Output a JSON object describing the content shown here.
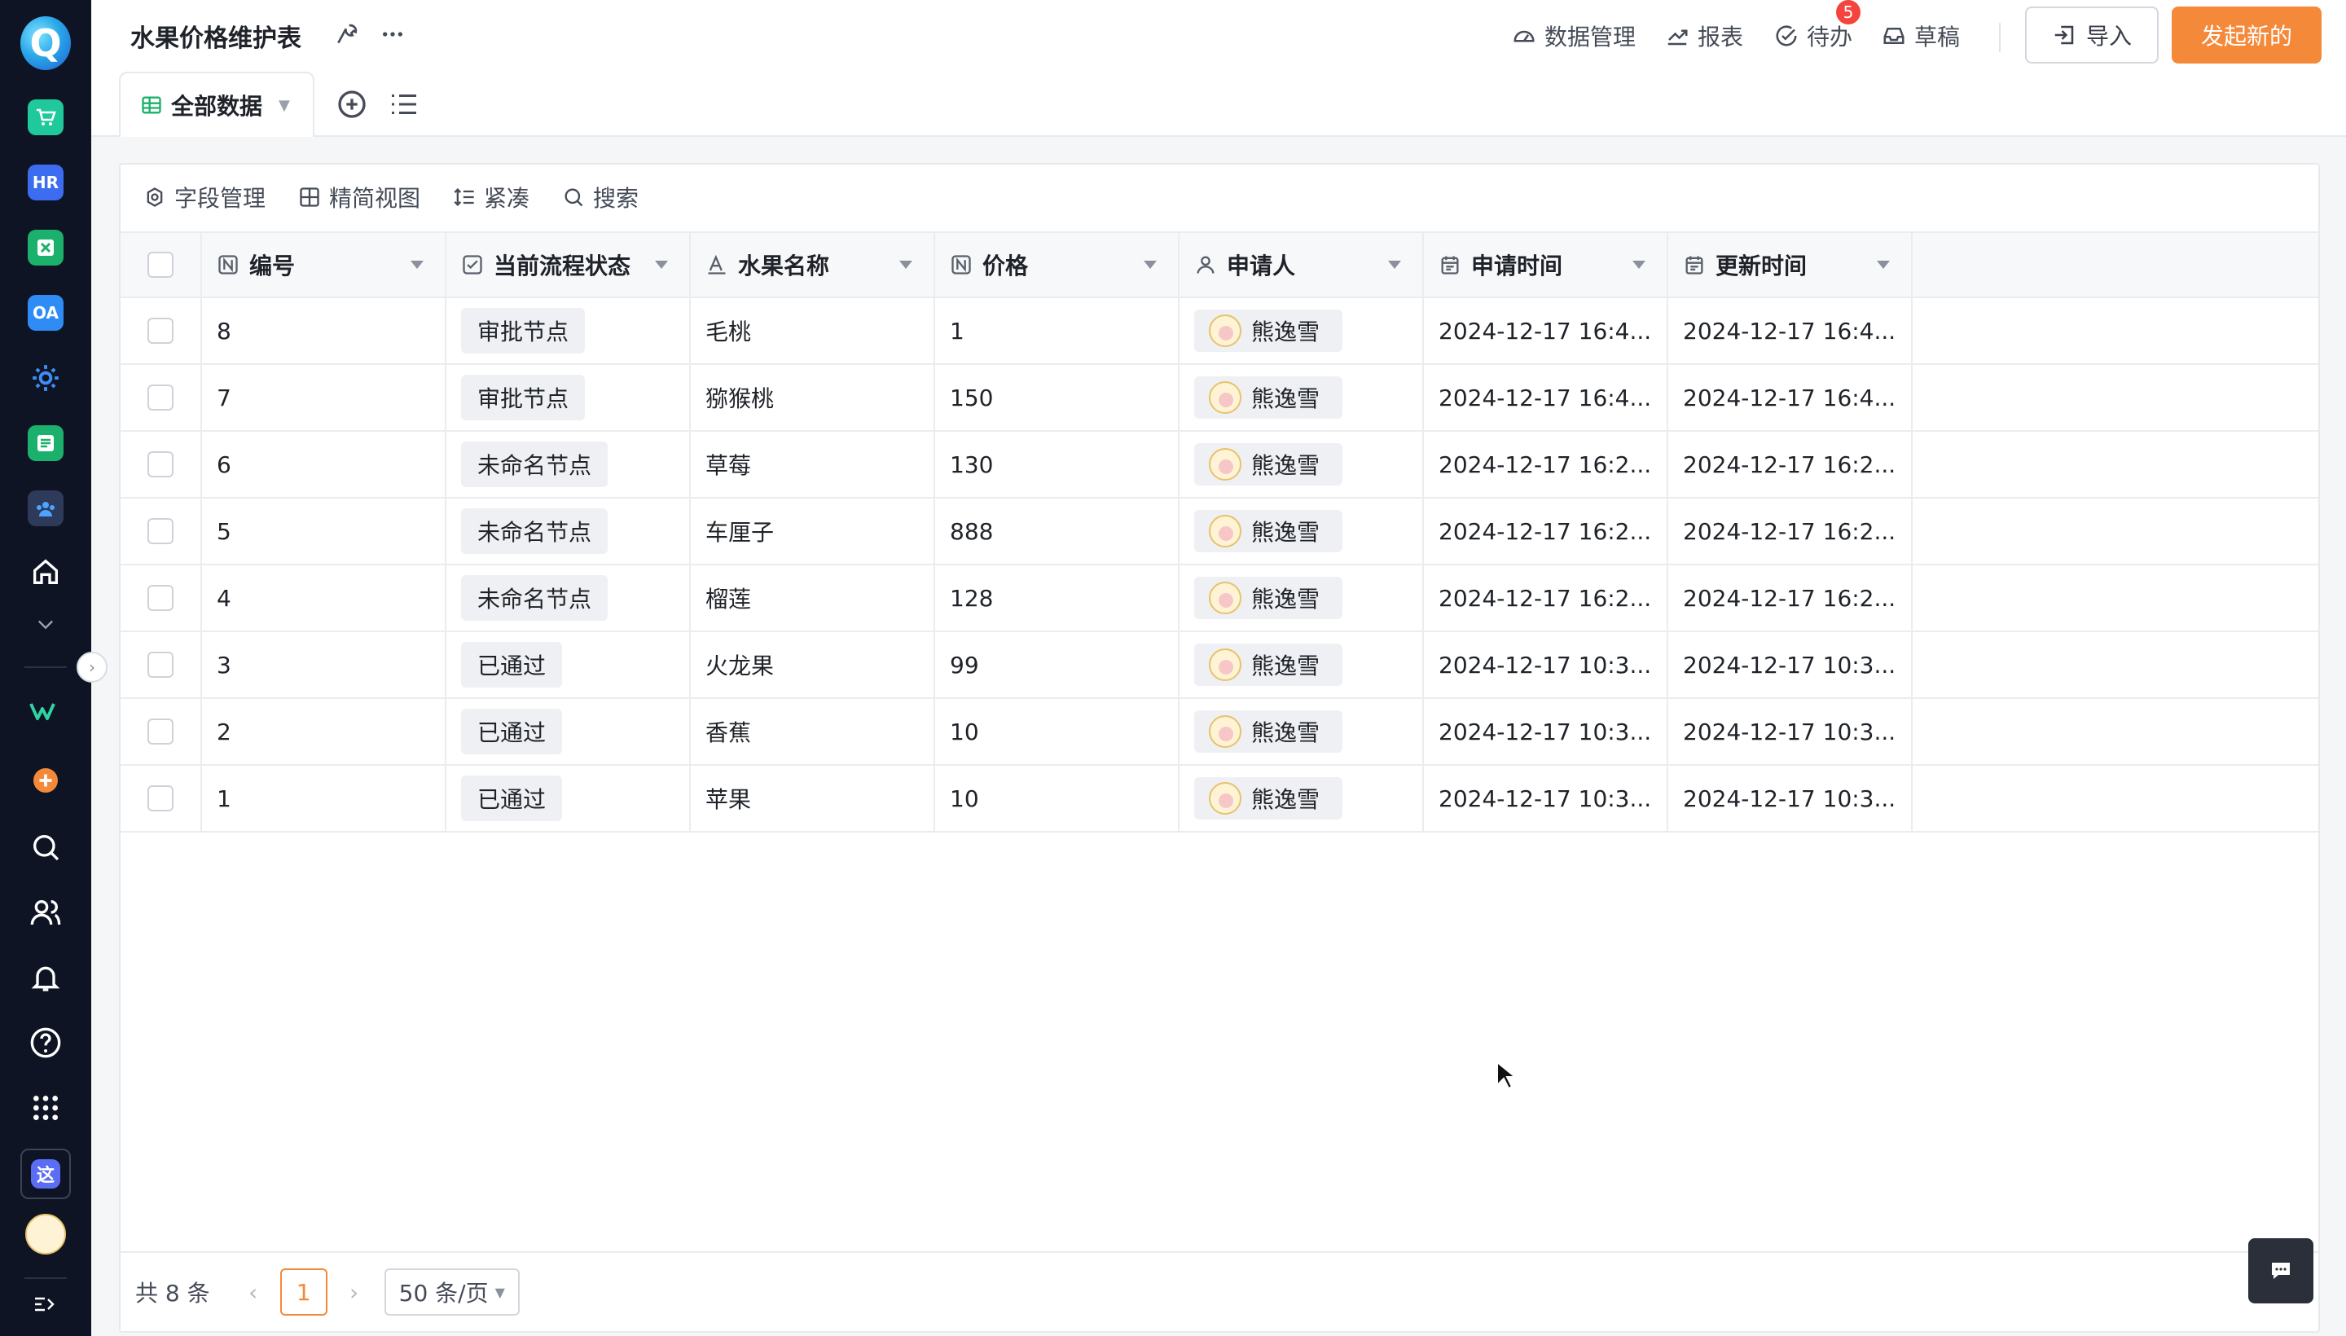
{
  "rail": {
    "apps": [
      {
        "icon": "store-app-icon",
        "color": "#1fc99c",
        "label": ""
      },
      {
        "icon": "hr-app-icon",
        "color": "#3c6cf0",
        "label": "HR"
      },
      {
        "icon": "excel-app-icon",
        "color": "#1bb06b",
        "label": ""
      },
      {
        "icon": "oa-app-icon",
        "color": "#2f8cf5",
        "label": "OA"
      },
      {
        "icon": "gear-app-icon",
        "color": "#3d8df5",
        "label": ""
      },
      {
        "icon": "form-app-icon",
        "color": "#1bb06b",
        "label": ""
      },
      {
        "icon": "team-app-icon",
        "color": "#2d3a5a",
        "label": ""
      }
    ],
    "logo_letter": "Q",
    "workspace_letter": "这"
  },
  "header": {
    "title": "水果价格维护表",
    "links": {
      "data_manage": "数据管理",
      "report": "报表",
      "todo": "待办",
      "todo_badge": "5",
      "draft": "草稿"
    },
    "import_label": "导入",
    "new_label": "发起新的",
    "accent_color": "#f5893a"
  },
  "view_tab": {
    "label": "全部数据"
  },
  "toolbar": {
    "field_manage": "字段管理",
    "compact_view": "精简视图",
    "density": "紧凑",
    "search": "搜索"
  },
  "table": {
    "columns": {
      "num": "编号",
      "status": "当前流程状态",
      "name": "水果名称",
      "price": "价格",
      "applicant": "申请人",
      "apply_time": "申请时间",
      "update_time": "更新时间"
    },
    "rows": [
      {
        "num": "8",
        "status": "审批节点",
        "name": "毛桃",
        "price": "1",
        "applicant": "熊逸雪",
        "apply_time": "2024-12-17 16:4...",
        "update_time": "2024-12-17 16:4..."
      },
      {
        "num": "7",
        "status": "审批节点",
        "name": "猕猴桃",
        "price": "150",
        "applicant": "熊逸雪",
        "apply_time": "2024-12-17 16:4...",
        "update_time": "2024-12-17 16:4..."
      },
      {
        "num": "6",
        "status": "未命名节点",
        "name": "草莓",
        "price": "130",
        "applicant": "熊逸雪",
        "apply_time": "2024-12-17 16:2...",
        "update_time": "2024-12-17 16:2..."
      },
      {
        "num": "5",
        "status": "未命名节点",
        "name": "车厘子",
        "price": "888",
        "applicant": "熊逸雪",
        "apply_time": "2024-12-17 16:2...",
        "update_time": "2024-12-17 16:2..."
      },
      {
        "num": "4",
        "status": "未命名节点",
        "name": "榴莲",
        "price": "128",
        "applicant": "熊逸雪",
        "apply_time": "2024-12-17 16:2...",
        "update_time": "2024-12-17 16:2..."
      },
      {
        "num": "3",
        "status": "已通过",
        "name": "火龙果",
        "price": "99",
        "applicant": "熊逸雪",
        "apply_time": "2024-12-17 10:3...",
        "update_time": "2024-12-17 10:3..."
      },
      {
        "num": "2",
        "status": "已通过",
        "name": "香蕉",
        "price": "10",
        "applicant": "熊逸雪",
        "apply_time": "2024-12-17 10:3...",
        "update_time": "2024-12-17 10:3..."
      },
      {
        "num": "1",
        "status": "已通过",
        "name": "苹果",
        "price": "10",
        "applicant": "熊逸雪",
        "apply_time": "2024-12-17 10:3...",
        "update_time": "2024-12-17 10:3..."
      }
    ]
  },
  "pager": {
    "total": "共 8 条",
    "current_page": "1",
    "page_size": "50 条/页"
  }
}
